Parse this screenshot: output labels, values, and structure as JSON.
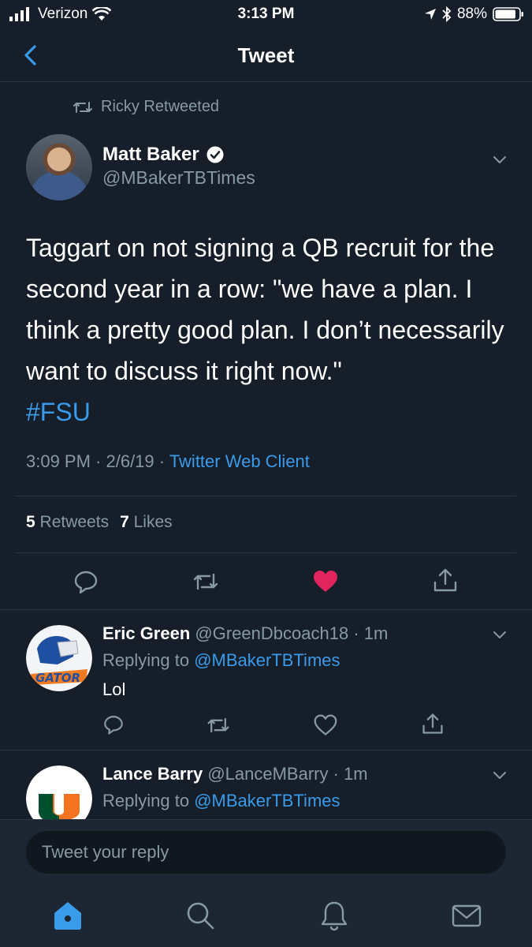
{
  "status_bar": {
    "carrier": "Verizon",
    "time": "3:13 PM",
    "battery": "88%",
    "battery_level": 0.88
  },
  "nav": {
    "title": "Tweet",
    "back_icon": "chevron-left-icon"
  },
  "tweet": {
    "retweeted_by": "Ricky Retweeted",
    "author_name": "Matt Baker",
    "author_handle": "@MBakerTBTimes",
    "verified": true,
    "text": "Taggart on not signing a QB recruit for the second year in a row: \"we have a plan. I think a pretty good plan. I don’t necessarily want to discuss it right now.\"",
    "hashtag": "#FSU",
    "timestamp": "3:09 PM · 2/6/19 · ",
    "client": "Twitter Web Client",
    "retweets_count": "5",
    "retweets_label": "Retweets",
    "likes_count": "7",
    "likes_label": "Likes",
    "liked": true
  },
  "replies": [
    {
      "name": "Eric Green",
      "handle": "@GreenDbcoach18",
      "time": "· 1m",
      "replying_prefix": "Replying to ",
      "replying_to": "@MBakerTBTimes",
      "text": "Lol"
    },
    {
      "name": "Lance Barry",
      "handle": "@LanceMBarry",
      "time": "· 1m",
      "replying_prefix": "Replying to ",
      "replying_to": "@MBakerTBTimes",
      "text": ""
    }
  ],
  "compose": {
    "placeholder": "Tweet your reply"
  },
  "colors": {
    "background": "#151e29",
    "accent": "#3a9bea",
    "muted": "#8899a6",
    "like": "#e0245e"
  },
  "tabs": [
    "home-icon",
    "search-icon",
    "notifications-icon",
    "messages-icon"
  ]
}
